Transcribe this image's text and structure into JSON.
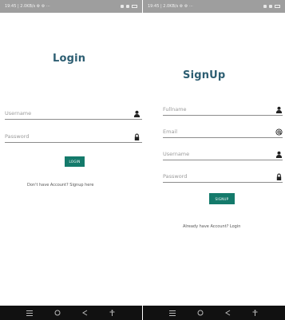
{
  "left": {
    "status": {
      "time": "19:45 | 2.0KB/s ⚙ ⚙ ⋯",
      "icons": "wifi, signal, battery"
    },
    "title": "Login",
    "fields": [
      {
        "label": "Username",
        "icon": "person-icon"
      },
      {
        "label": "Password",
        "icon": "lock-icon"
      }
    ],
    "button_label": "LOGIN",
    "footer": "Don't have Account? Signup here"
  },
  "right": {
    "status": {
      "time": "19:45 | 2.0KB/s ⚙ ⚙ ⋯",
      "icons": "wifi, signal, battery"
    },
    "title": "SignUp",
    "fields": [
      {
        "label": "Fullname",
        "icon": "person-icon"
      },
      {
        "label": "Email",
        "icon": "at-icon"
      },
      {
        "label": "Username",
        "icon": "person-icon"
      },
      {
        "label": "Password",
        "icon": "lock-icon"
      }
    ],
    "button_label": "SIGNUP",
    "footer": "Already have Account? Login"
  },
  "nav_icons": [
    "menu-icon",
    "home-icon",
    "back-icon",
    "accessibility-icon"
  ],
  "colors": {
    "accent": "#2d5e72",
    "button": "#147a6b",
    "status_bar": "#9e9e9e",
    "nav_bar": "#111111"
  }
}
